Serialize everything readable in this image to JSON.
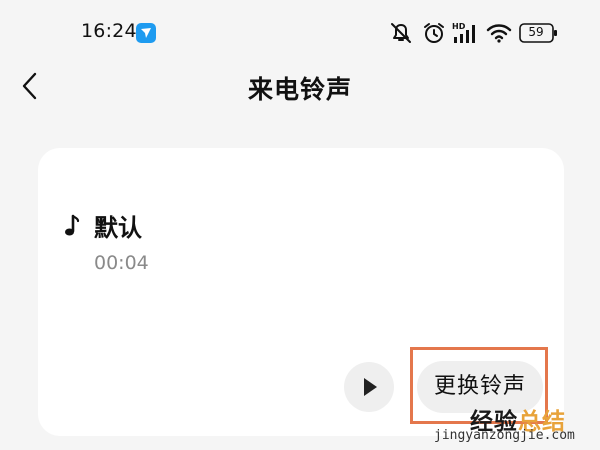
{
  "status_bar": {
    "time": "16:24",
    "battery": "59",
    "icons": [
      "app-notification-icon",
      "mute-icon",
      "alarm-icon",
      "hd-signal-icon",
      "wifi-icon",
      "battery-icon"
    ],
    "signal_label": "HD"
  },
  "header": {
    "title": "来电铃声",
    "back_icon": "back-chevron-icon"
  },
  "card": {
    "ringtone_name": "默认",
    "duration": "00:04",
    "note_icon": "music-note-icon",
    "play_icon": "play-icon",
    "change_button_label": "更换铃声"
  },
  "watermark": {
    "title_main": "经验",
    "title_accent": "总结",
    "url": "jingyanzongjie.com"
  },
  "colors": {
    "background": "#f5f5f5",
    "card": "#ffffff",
    "button_bg": "#efefef",
    "highlight_border": "#e4774c",
    "watermark_accent": "#e8a33a",
    "app_icon": "#1e9bf0"
  }
}
